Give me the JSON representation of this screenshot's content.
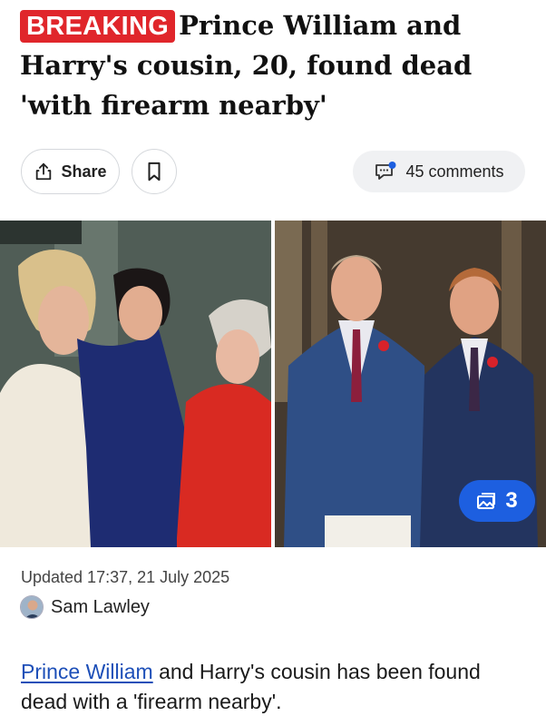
{
  "headline": {
    "badge": "BREAKING",
    "title": "Prince William and Harry's cousin, 20, found dead 'with firearm nearby'"
  },
  "actions": {
    "share_label": "Share",
    "bookmark_icon": "bookmark-icon",
    "comments_label": "45 comments"
  },
  "gallery": {
    "count": "3"
  },
  "meta": {
    "updated": "Updated 17:37, 21 July 2025",
    "author": "Sam Lawley"
  },
  "lede": {
    "link_text": "Prince William",
    "rest_text": " and Harry's cousin has been found dead with a 'firearm nearby'."
  },
  "colors": {
    "breaking_red": "#e0262b",
    "link_blue": "#1d4fb8",
    "gallery_blue": "#1d5fe0"
  }
}
